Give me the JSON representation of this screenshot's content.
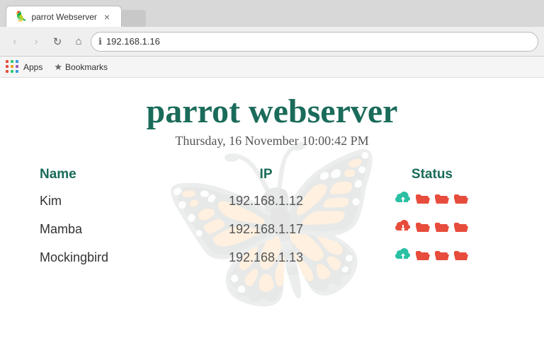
{
  "browser": {
    "tab": {
      "favicon": "🦜",
      "title": "parrot Webserver",
      "close_label": "×"
    },
    "new_tab_placeholder": "",
    "toolbar": {
      "back_label": "‹",
      "forward_label": "›",
      "reload_label": "↻",
      "home_label": "⌂",
      "address": "192.168.1.16",
      "info_icon": "ℹ"
    },
    "bookmarks_bar": {
      "apps_label": "Apps",
      "bookmark_icon": "★",
      "bookmarks_label": "Bookmarks"
    }
  },
  "page": {
    "title": "parrot webserver",
    "datetime": "Thursday, 16 November 10:00:42 PM",
    "table": {
      "headers": {
        "name": "Name",
        "ip": "IP",
        "status": "Status"
      },
      "rows": [
        {
          "name": "Kim",
          "ip": "192.168.1.12",
          "upload": true,
          "folders": 3
        },
        {
          "name": "Mamba",
          "ip": "192.168.1.17",
          "upload": false,
          "folders": 3
        },
        {
          "name": "Mockingbird",
          "ip": "192.168.1.13",
          "upload": true,
          "folders": 3
        }
      ]
    }
  },
  "apps_dots": {
    "colors": [
      "#e74c3c",
      "#2ecc71",
      "#3498db",
      "#e74c3c",
      "#f39c12",
      "#9b59b6",
      "#e74c3c",
      "#2ecc71",
      "#3498db"
    ]
  }
}
